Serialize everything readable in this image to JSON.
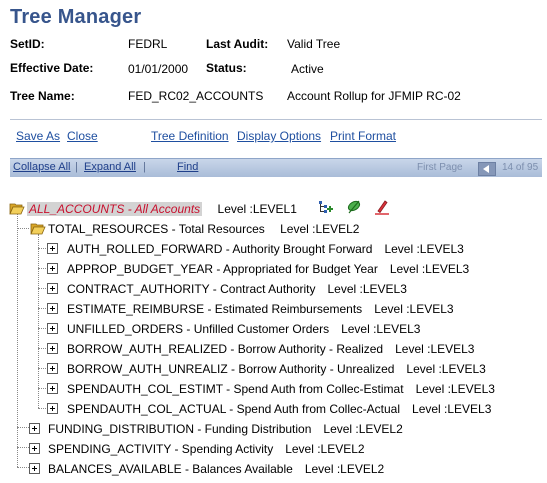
{
  "page": {
    "title": "Tree Manager"
  },
  "info": {
    "setid_label": "SetID:",
    "setid_value": "FEDRL",
    "last_audit_label": "Last Audit:",
    "last_audit_value": "Valid Tree",
    "eff_date_label": "Effective Date:",
    "eff_date_value": "01/01/2000",
    "status_label": "Status:",
    "status_value": "Active",
    "tree_name_label": "Tree Name:",
    "tree_name_value": "FED_RC02_ACCOUNTS",
    "tree_desc": "Account Rollup for JFMIP RC-02"
  },
  "actions": {
    "save_as": "Save As",
    "close": "Close",
    "tree_definition": "Tree Definition",
    "display_options": "Display Options",
    "print_format": "Print Format"
  },
  "navbar": {
    "collapse_all": "Collapse All",
    "expand_all": "Expand All",
    "find": "Find",
    "first_page": "First Page",
    "page_count": "14 of 95"
  },
  "tree": {
    "root": {
      "name": "ALL_ACCOUNTS - All Accounts",
      "level": "Level :LEVEL1"
    },
    "level2_first": {
      "name": "TOTAL_RESOURCES - Total Resources",
      "level": "Level :LEVEL2"
    },
    "level3": [
      {
        "name": "AUTH_ROLLED_FORWARD - Authority Brought Forward",
        "level": "Level :LEVEL3"
      },
      {
        "name": "APPROP_BUDGET_YEAR - Appropriated for Budget Year",
        "level": "Level :LEVEL3"
      },
      {
        "name": "CONTRACT_AUTHORITY - Contract Authority",
        "level": "Level :LEVEL3"
      },
      {
        "name": "ESTIMATE_REIMBURSE - Estimated Reimbursements",
        "level": "Level :LEVEL3"
      },
      {
        "name": "UNFILLED_ORDERS - Unfilled Customer Orders",
        "level": "Level :LEVEL3"
      },
      {
        "name": "BORROW_AUTH_REALIZED - Borrow Authority - Realized",
        "level": "Level :LEVEL3"
      },
      {
        "name": "BORROW_AUTH_UNREALIZ - Borrow Authority - Unrealized",
        "level": "Level :LEVEL3"
      },
      {
        "name": "SPENDAUTH_COL_ESTIMT - Spend Auth from Collec-Estimat",
        "level": "Level :LEVEL3"
      },
      {
        "name": "SPENDAUTH_COL_ACTUAL - Spend Auth from Collec-Actual",
        "level": "Level :LEVEL3"
      }
    ],
    "level2_rest": [
      {
        "name": "FUNDING_DISTRIBUTION - Funding Distribution",
        "level": "Level :LEVEL2"
      },
      {
        "name": "SPENDING_ACTIVITY - Spending Activity",
        "level": "Level :LEVEL2"
      },
      {
        "name": "BALANCES_AVAILABLE - Balances Available",
        "level": "Level :LEVEL2"
      }
    ]
  },
  "colors": {
    "title": "#37558c",
    "link": "#1f4fa0",
    "root_text": "#c8102e",
    "navbar": "#b9c9e2"
  },
  "icons": [
    "folder-open-icon",
    "insert-child-icon",
    "insert-sibling-icon",
    "edit-data-icon",
    "expand-plus-icon"
  ]
}
